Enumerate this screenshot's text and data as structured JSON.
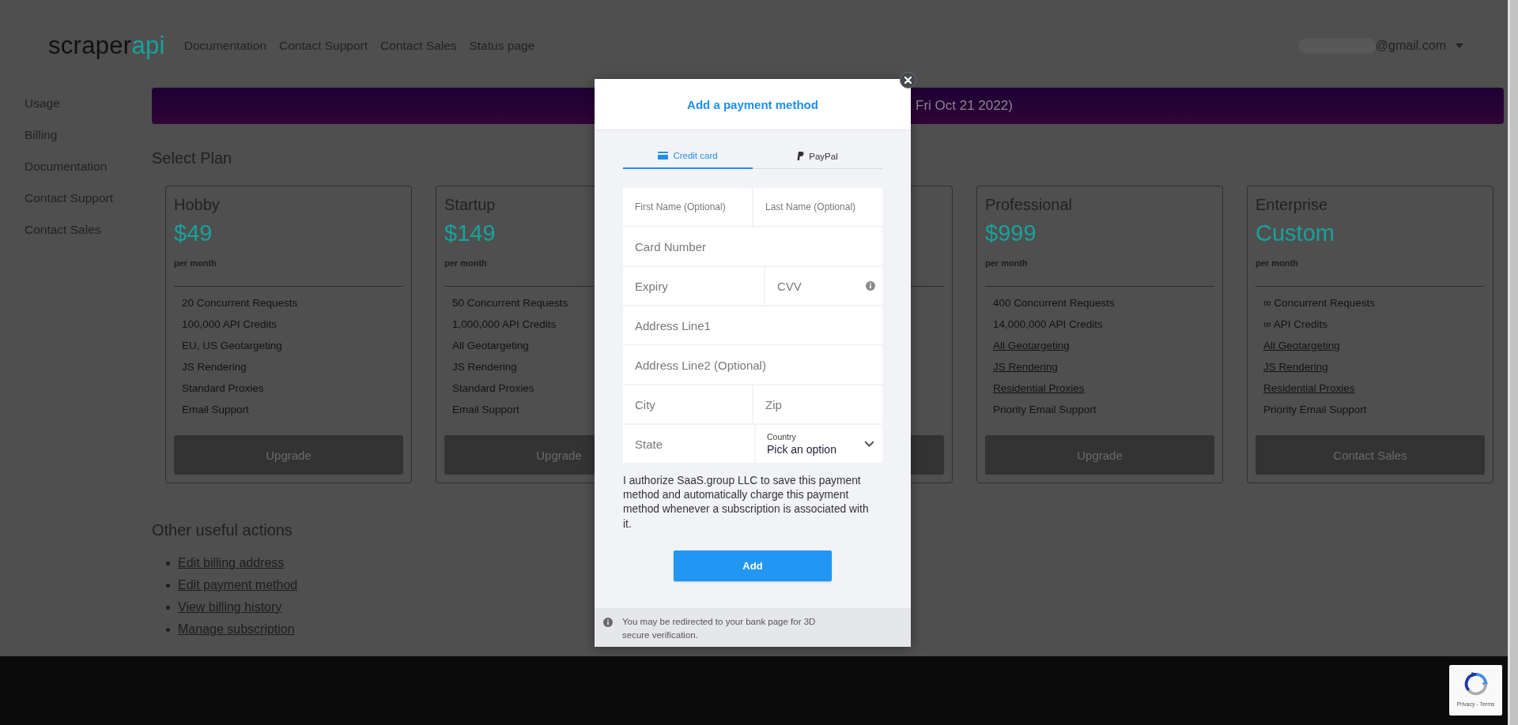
{
  "header": {
    "logo": {
      "part_1": "scraper",
      "part_2": "api"
    },
    "nav": [
      "Documentation",
      "Contact Support",
      "Contact Sales",
      "Status page"
    ],
    "account": {
      "email": "@gmail.com"
    }
  },
  "sidebar": {
    "items": [
      "Usage",
      "Billing",
      "Documentation",
      "Contact Support",
      "Contact Sales"
    ]
  },
  "banner": {
    "text": "Fri Oct 21 2022)"
  },
  "plans_section": {
    "title": "Select Plan",
    "plans": [
      {
        "kind": "card",
        "name": "Hobby",
        "price": "$49",
        "period": "per month",
        "features": [
          {
            "text": "20 Concurrent Requests",
            "linked": false
          },
          {
            "text": "100,000 API Credits",
            "linked": false
          },
          {
            "text": "EU, US Geotargeting",
            "linked": false
          },
          {
            "text": "JS Rendering",
            "linked": false
          },
          {
            "text": "Standard Proxies",
            "linked": false
          },
          {
            "text": "Email Support",
            "linked": false
          }
        ],
        "button": "Upgrade"
      },
      {
        "kind": "card",
        "name": "Startup",
        "price": "$149",
        "period": "per month",
        "features": [
          {
            "text": "50 Concurrent Requests",
            "linked": false
          },
          {
            "text": "1,000,000 API Credits",
            "linked": false
          },
          {
            "text": "All Geotargeting",
            "linked": false
          },
          {
            "text": "JS Rendering",
            "linked": false
          },
          {
            "text": "Standard Proxies",
            "linked": false
          },
          {
            "text": "Email Support",
            "linked": false
          }
        ],
        "button": "Upgrade"
      },
      {
        "kind": "covered"
      },
      {
        "kind": "card",
        "name": "Professional",
        "price": "$999",
        "period": "per month",
        "features": [
          {
            "text": "400 Concurrent Requests",
            "linked": false
          },
          {
            "text": "14,000,000 API Credits",
            "linked": false
          },
          {
            "text": "All Geotargeting",
            "linked": true
          },
          {
            "text": "JS Rendering",
            "linked": true
          },
          {
            "text": "Residential Proxies",
            "linked": true
          },
          {
            "text": "Priority Email Support",
            "linked": false
          }
        ],
        "button": "Upgrade"
      },
      {
        "kind": "card",
        "name": "Enterprise",
        "price": "Custom",
        "period": "per month",
        "features": [
          {
            "text": "∞ Concurrent Requests",
            "linked": false
          },
          {
            "text": "∞ API Credits",
            "linked": false
          },
          {
            "text": "All Geotargeting",
            "linked": true
          },
          {
            "text": "JS Rendering",
            "linked": true
          },
          {
            "text": "Residential Proxies",
            "linked": true
          },
          {
            "text": "Priority Email Support",
            "linked": false
          }
        ],
        "button": "Contact Sales"
      }
    ]
  },
  "actions": {
    "title": "Other useful actions",
    "links": [
      "Edit billing address",
      "Edit payment method",
      "View billing history",
      "Manage subscription"
    ]
  },
  "modal": {
    "title": "Add a payment method",
    "tabs": [
      {
        "label": "Credit card",
        "selected": true
      },
      {
        "label": "PayPal",
        "selected": false
      }
    ],
    "rows": [
      [
        {
          "kind": "compact",
          "placeholder": "First Name (Optional)"
        },
        {
          "kind": "compact",
          "placeholder": "Last Name (Optional)"
        }
      ],
      [
        {
          "kind": "text",
          "placeholder": "Card Number"
        }
      ],
      [
        {
          "kind": "text",
          "placeholder": "Expiry"
        },
        {
          "kind": "info",
          "placeholder": "CVV"
        }
      ],
      [
        {
          "kind": "text",
          "placeholder": "Address Line1"
        }
      ],
      [
        {
          "kind": "text",
          "placeholder": "Address Line2 (Optional)"
        }
      ],
      [
        {
          "kind": "text",
          "placeholder": "City"
        },
        {
          "kind": "text",
          "placeholder": "Zip"
        }
      ],
      [
        {
          "kind": "text",
          "placeholder": "State"
        },
        {
          "kind": "select",
          "label": "Country",
          "value": "Pick an option"
        }
      ]
    ],
    "consent": "I authorize SaaS.group LLC to save this payment method and automatically charge this payment method whenever a subscription is associated with it.",
    "submit": "Add",
    "note": "You may be redirected to your bank page for 3D secure verification."
  },
  "recaptcha": {
    "text": "Privacy - Terms"
  }
}
